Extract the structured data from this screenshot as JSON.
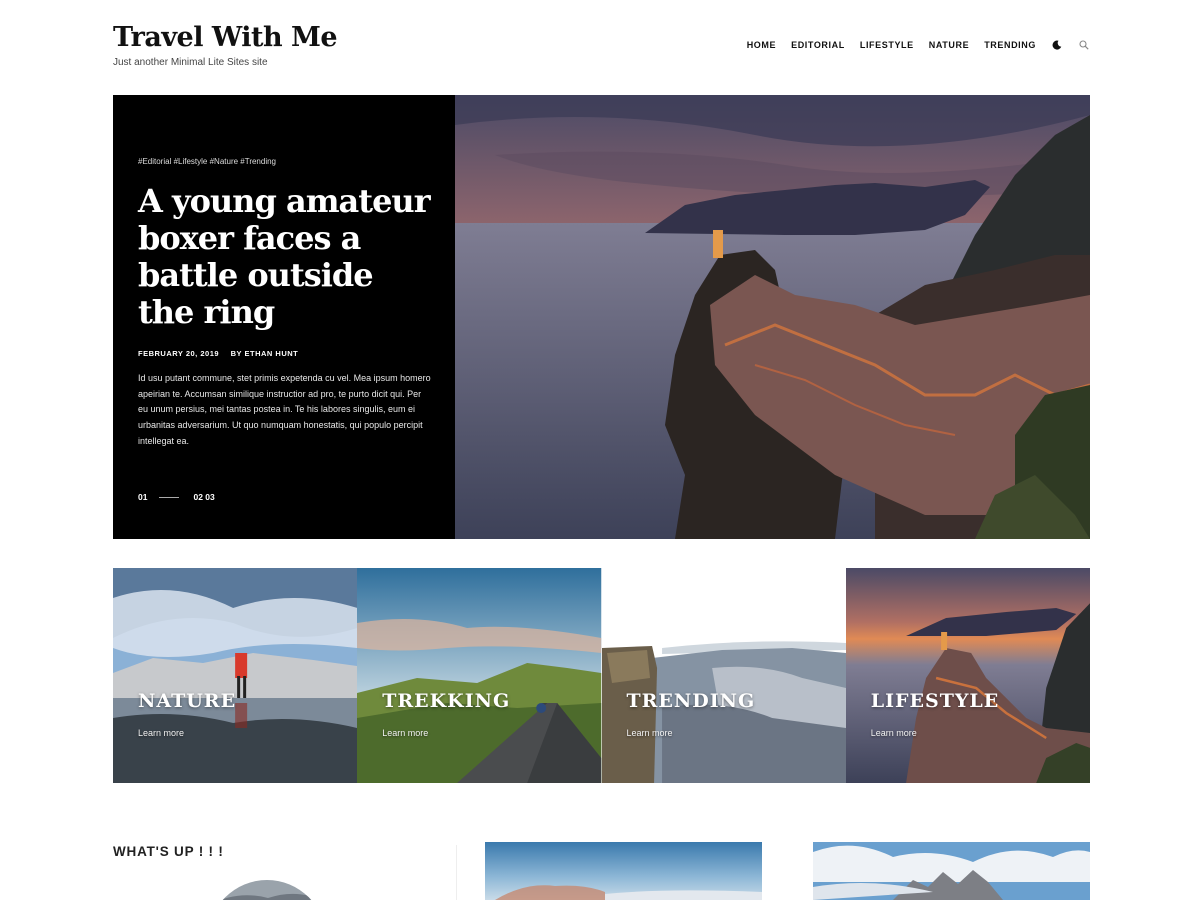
{
  "site": {
    "title": "Travel With Me",
    "tagline": "Just another Minimal Lite Sites site"
  },
  "nav": {
    "items": [
      "HOME",
      "EDITORIAL",
      "LIFESTYLE",
      "NATURE",
      "TRENDING"
    ],
    "icons": [
      "moon-icon",
      "search-icon"
    ]
  },
  "hero": {
    "tags": "#Editorial #Lifestyle #Nature #Trending",
    "title": "A young amateur boxer faces a battle outside the ring",
    "date": "FEBRUARY 20, 2019",
    "author": "BY ETHAN HUNT",
    "excerpt": "Id usu putant commune, stet primis expetenda cu vel. Mea ipsum homero apeirian te. Accumsan similique instructior ad pro, te purto dicit qui. Per eu unum persius, mei tantas postea in. Te his labores singulis, eum ei urbanitas adversarium. Ut quo numquam honestatis, qui populo percipit intellegat ea.",
    "pager_current": "01",
    "pager_rest": "02 03"
  },
  "categories": [
    {
      "title": "NATURE",
      "link": "Learn more"
    },
    {
      "title": "TREKKING",
      "link": "Learn more"
    },
    {
      "title": "TRENDING",
      "link": "Learn more"
    },
    {
      "title": "LIFESTYLE",
      "link": "Learn more"
    }
  ],
  "section": {
    "title": "WHAT'S UP ! ! !"
  },
  "colors": {
    "accent": "#000000",
    "background": "#ffffff"
  }
}
